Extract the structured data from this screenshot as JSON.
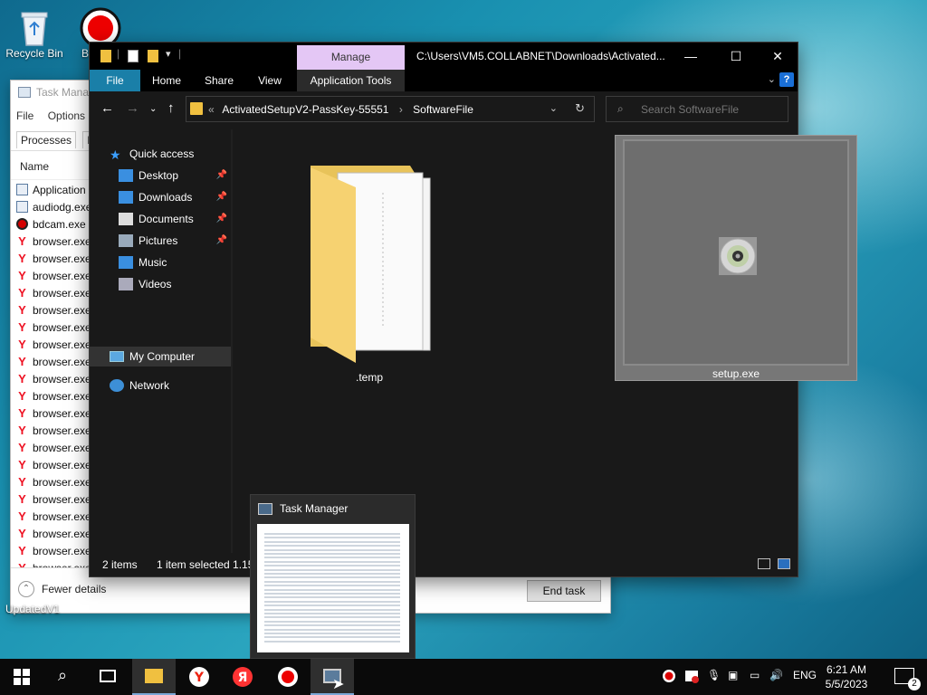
{
  "desktop": {
    "icons": [
      {
        "label": "Recycle Bin"
      },
      {
        "label": "B"
      }
    ],
    "partial_label": "UpdatedV1"
  },
  "task_manager_bg": {
    "title": "Task Manag",
    "menu": [
      "File",
      "Options"
    ],
    "tabs": [
      "Processes",
      "Per"
    ],
    "column_name": "Name",
    "rows": [
      {
        "name": "Application",
        "icon": "app"
      },
      {
        "name": "audiodg.exe",
        "icon": "app"
      },
      {
        "name": "bdcam.exe",
        "icon": "record"
      },
      {
        "name": "browser.exe",
        "icon": "yandex"
      },
      {
        "name": "browser.exe",
        "icon": "yandex"
      },
      {
        "name": "browser.exe",
        "icon": "yandex"
      },
      {
        "name": "browser.exe",
        "icon": "yandex"
      },
      {
        "name": "browser.exe",
        "icon": "yandex"
      },
      {
        "name": "browser.exe",
        "icon": "yandex"
      },
      {
        "name": "browser.exe",
        "icon": "yandex"
      },
      {
        "name": "browser.exe",
        "icon": "yandex"
      },
      {
        "name": "browser.exe",
        "icon": "yandex"
      },
      {
        "name": "browser.exe",
        "icon": "yandex"
      },
      {
        "name": "browser.exe",
        "icon": "yandex"
      },
      {
        "name": "browser.exe",
        "icon": "yandex"
      },
      {
        "name": "browser.exe",
        "icon": "yandex"
      },
      {
        "name": "browser.exe",
        "icon": "yandex"
      },
      {
        "name": "browser.exe",
        "icon": "yandex"
      },
      {
        "name": "browser.exe",
        "icon": "yandex"
      },
      {
        "name": "browser.exe",
        "icon": "yandex"
      },
      {
        "name": "browser.exe",
        "icon": "yandex"
      },
      {
        "name": "browser.exe",
        "icon": "yandex"
      },
      {
        "name": "browser.exe",
        "icon": "yandex"
      }
    ],
    "fewer_details": "Fewer details",
    "end_task": "End task"
  },
  "explorer": {
    "manage_tab": "Manage",
    "title_path": "C:\\Users\\VM5.COLLABNET\\Downloads\\Activated...",
    "ribbon_tabs": [
      "File",
      "Home",
      "Share",
      "View",
      "Application Tools"
    ],
    "breadcrumb": {
      "overflow": "«",
      "parts": [
        "ActivatedSetupV2-PassKey-55551",
        "SoftwareFile"
      ],
      "separator": "›"
    },
    "search_placeholder": "Search SoftwareFile",
    "nav": {
      "quick_access": "Quick access",
      "items": [
        {
          "label": "Desktop",
          "icon": "desktop-icon",
          "pinned": true
        },
        {
          "label": "Downloads",
          "icon": "downloads-icon",
          "pinned": true
        },
        {
          "label": "Documents",
          "icon": "documents-icon",
          "pinned": true
        },
        {
          "label": "Pictures",
          "icon": "pictures-icon",
          "pinned": true
        },
        {
          "label": "Music",
          "icon": "music-icon",
          "pinned": false
        },
        {
          "label": "Videos",
          "icon": "videos-icon",
          "pinned": false
        }
      ],
      "my_computer": "My Computer",
      "network": "Network"
    },
    "files": [
      {
        "name": ".temp",
        "type": "folder",
        "selected": false
      },
      {
        "name": "setup.exe",
        "type": "installer",
        "selected": true
      }
    ],
    "status": {
      "count": "2 items",
      "selected": "1 item selected  1.15"
    }
  },
  "thumbnail": {
    "title": "Task Manager"
  },
  "taskbar": {
    "apps": [
      {
        "name": "file-explorer",
        "active": true
      },
      {
        "name": "yandex-browser",
        "active": false
      },
      {
        "name": "yandex",
        "active": false
      },
      {
        "name": "bandicam",
        "active": false
      },
      {
        "name": "task-manager",
        "active": true
      }
    ],
    "language": "ENG",
    "time": "6:21 AM",
    "date": "5/5/2023",
    "notification_count": "2"
  },
  "colors": {
    "file_tab": "#1a7fa8",
    "manage_tab": "#e4c7f5",
    "folder": "#f0c040"
  }
}
